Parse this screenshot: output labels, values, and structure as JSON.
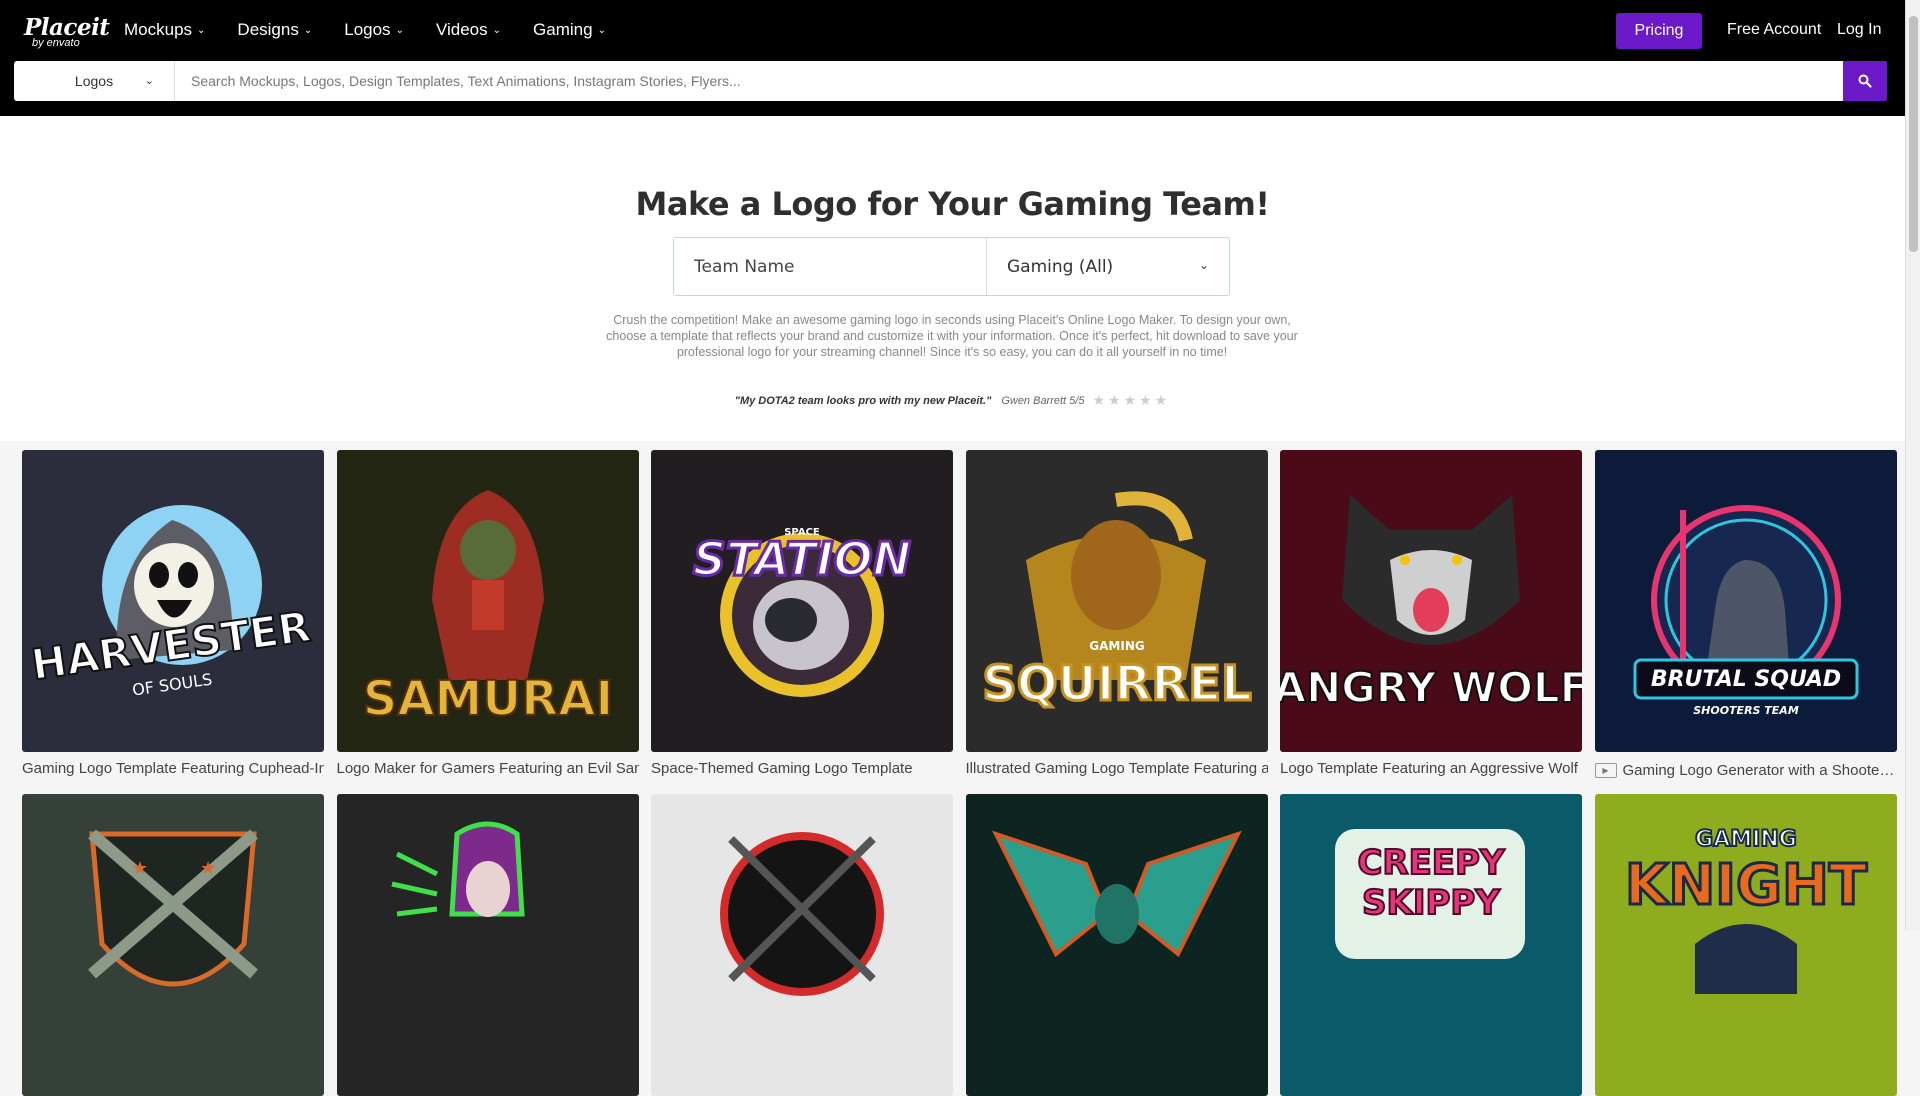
{
  "header": {
    "brand": "Placeit",
    "brand_sub": "by envato",
    "nav": [
      {
        "label": "Mockups"
      },
      {
        "label": "Designs"
      },
      {
        "label": "Logos"
      },
      {
        "label": "Videos"
      },
      {
        "label": "Gaming"
      }
    ],
    "pricing_label": "Pricing",
    "free_account_label": "Free Account",
    "login_label": "Log In",
    "accent_color": "#6b19c9"
  },
  "search": {
    "category": "Logos",
    "placeholder": "Search Mockups, Logos, Design Templates, Text Animations, Instagram Stories, Flyers...",
    "value": ""
  },
  "hero": {
    "title": "Make a Logo for Your Gaming Team!",
    "team_name_placeholder": "Team Name",
    "genre_value": "Gaming (All)",
    "description": "Crush the competition! Make an awesome gaming logo in seconds using Placeit's Online Logo Maker. To design your own, choose a template that reflects your brand and customize it with your information. Once it's perfect, hit download to save your professional logo for your streaming channel! Since it's so easy, you can do it all yourself in no time!",
    "quote": "\"My DOTA2 team looks pro with my new Placeit.\"",
    "quote_author": "Gwen Barrett 5/5",
    "rating": 5
  },
  "templates": [
    {
      "caption": "Gaming Logo Template Featuring Cuphead-Inspired Skull",
      "art_text": "HARVESTER",
      "art_sub": "OF SOULS",
      "bg": "#2b2d3c",
      "is_video": false
    },
    {
      "caption": "Logo Maker for Gamers Featuring an Evil Samurai",
      "art_text": "SAMURAI",
      "art_sub": "",
      "bg": "#232613",
      "is_video": false
    },
    {
      "caption": "Space-Themed Gaming Logo Template",
      "art_text": "STATION",
      "art_sub": "SPACE",
      "bg": "#221d21",
      "is_video": false
    },
    {
      "caption": "Illustrated Gaming Logo Template Featuring a Squirrel",
      "art_text": "SQUIRREL",
      "art_sub": "GAMING",
      "bg": "#2c2b2b",
      "is_video": false
    },
    {
      "caption": "Logo Template Featuring an Aggressive Wolf",
      "art_text": "ANGRY WOLF",
      "art_sub": "",
      "bg": "#4a0a17",
      "is_video": false
    },
    {
      "caption": "Gaming Logo Generator with a Shooter Character",
      "art_text": "BRUTAL SQUAD",
      "art_sub": "SHOOTERS TEAM",
      "bg": "#0c1b3a",
      "is_video": true
    },
    {
      "caption": "",
      "art_text": "",
      "art_sub": "",
      "bg": "#344038",
      "is_video": false
    },
    {
      "caption": "",
      "art_text": "",
      "art_sub": "",
      "bg": "#252525",
      "is_video": false
    },
    {
      "caption": "",
      "art_text": "",
      "art_sub": "",
      "bg": "#e6e6e6",
      "is_video": false
    },
    {
      "caption": "",
      "art_text": "",
      "art_sub": "",
      "bg": "#0d2420",
      "is_video": false
    },
    {
      "caption": "",
      "art_text": "CREEPY",
      "art_sub": "SKIPPY",
      "bg": "#0b5a6a",
      "is_video": false
    },
    {
      "caption": "",
      "art_text": "KNIGHT",
      "art_sub": "GAMING",
      "bg": "#8fac1f",
      "is_video": false
    }
  ]
}
